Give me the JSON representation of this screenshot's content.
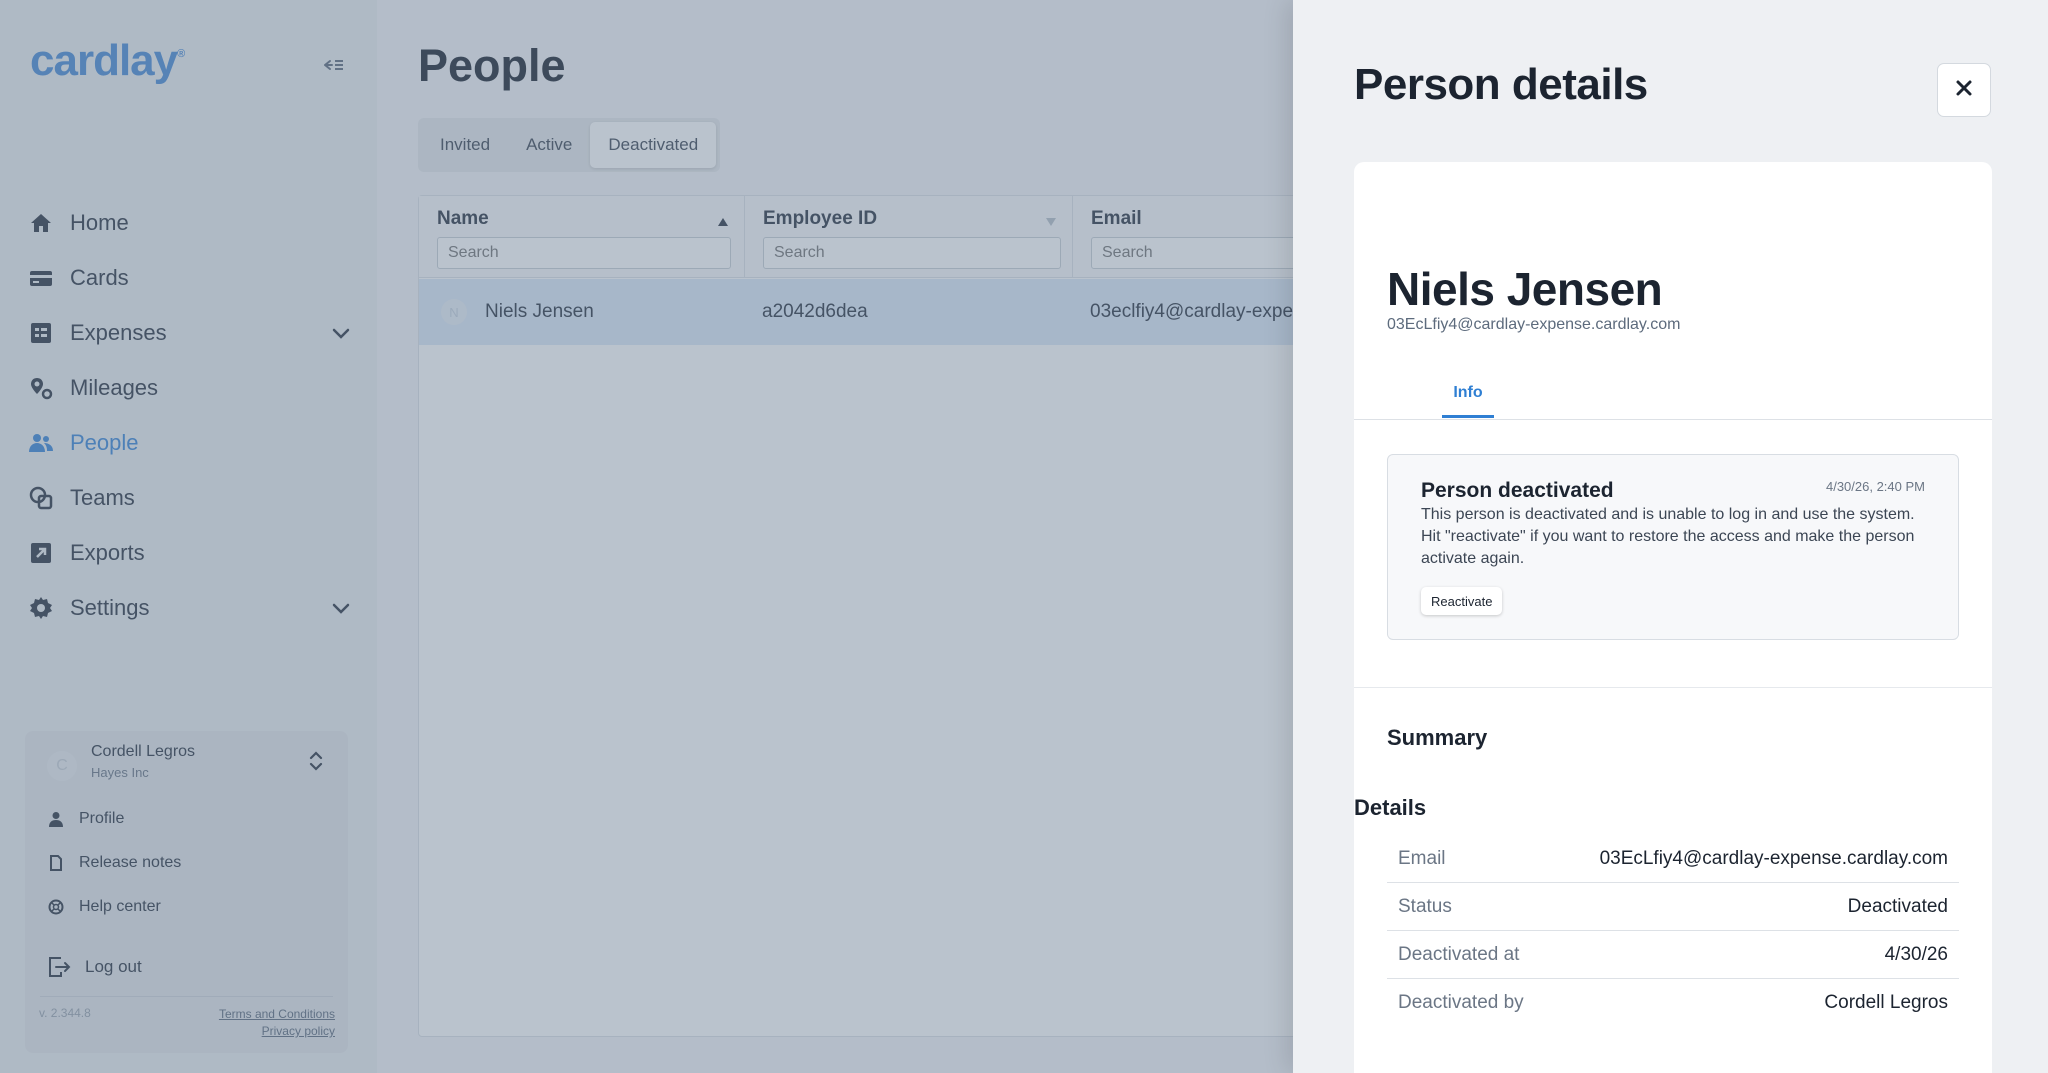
{
  "brand": {
    "logo": "cardlay",
    "registered": "®",
    "accent": "#3a86d8"
  },
  "sidebar": {
    "items": [
      {
        "label": "Home",
        "icon": "home-icon"
      },
      {
        "label": "Cards",
        "icon": "card-icon"
      },
      {
        "label": "Expenses",
        "icon": "receipt-icon",
        "expandable": true
      },
      {
        "label": "Mileages",
        "icon": "route-icon"
      },
      {
        "label": "People",
        "icon": "people-icon",
        "active": true
      },
      {
        "label": "Teams",
        "icon": "teams-icon"
      },
      {
        "label": "Exports",
        "icon": "export-icon"
      },
      {
        "label": "Settings",
        "icon": "gear-icon",
        "expandable": true
      }
    ],
    "user": {
      "initial": "C",
      "name": "Cordell Legros",
      "company": "Hayes Inc",
      "links": [
        "Profile",
        "Release notes",
        "Help center"
      ],
      "logout": "Log out",
      "version": "v. 2.344.8",
      "terms": "Terms and Conditions",
      "privacy": "Privacy policy"
    }
  },
  "main": {
    "title": "People",
    "tabs": [
      {
        "label": "Invited"
      },
      {
        "label": "Active"
      },
      {
        "label": "Deactivated",
        "active": true
      }
    ],
    "columns": [
      {
        "title": "Name",
        "placeholder": "Search"
      },
      {
        "title": "Employee ID",
        "placeholder": "Search"
      },
      {
        "title": "Email",
        "placeholder": "Search"
      }
    ],
    "rows": [
      {
        "initial": "N",
        "name": "Niels Jensen",
        "employee_id": "a2042d6dea",
        "email": "03eclfiy4@cardlay-expe"
      }
    ]
  },
  "drawer": {
    "title": "Person details",
    "person_name": "Niels Jensen",
    "person_email": "03EcLfiy4@cardlay-expense.cardlay.com",
    "tab": "Info",
    "notice": {
      "title": "Person deactivated",
      "time": "4/30/26, 2:40 PM",
      "body": "This person is deactivated and is unable to log in and use the system. Hit \"reactivate\" if you want to restore the access and make the person activate again.",
      "button": "Reactivate"
    },
    "summary_title": "Summary",
    "details_title": "Details",
    "details": [
      {
        "label": "Email",
        "value": "03EcLfiy4@cardlay-expense.cardlay.com"
      },
      {
        "label": "Status",
        "value": "Deactivated"
      },
      {
        "label": "Deactivated at",
        "value": "4/30/26"
      },
      {
        "label": "Deactivated by",
        "value": "Cordell Legros"
      }
    ]
  }
}
